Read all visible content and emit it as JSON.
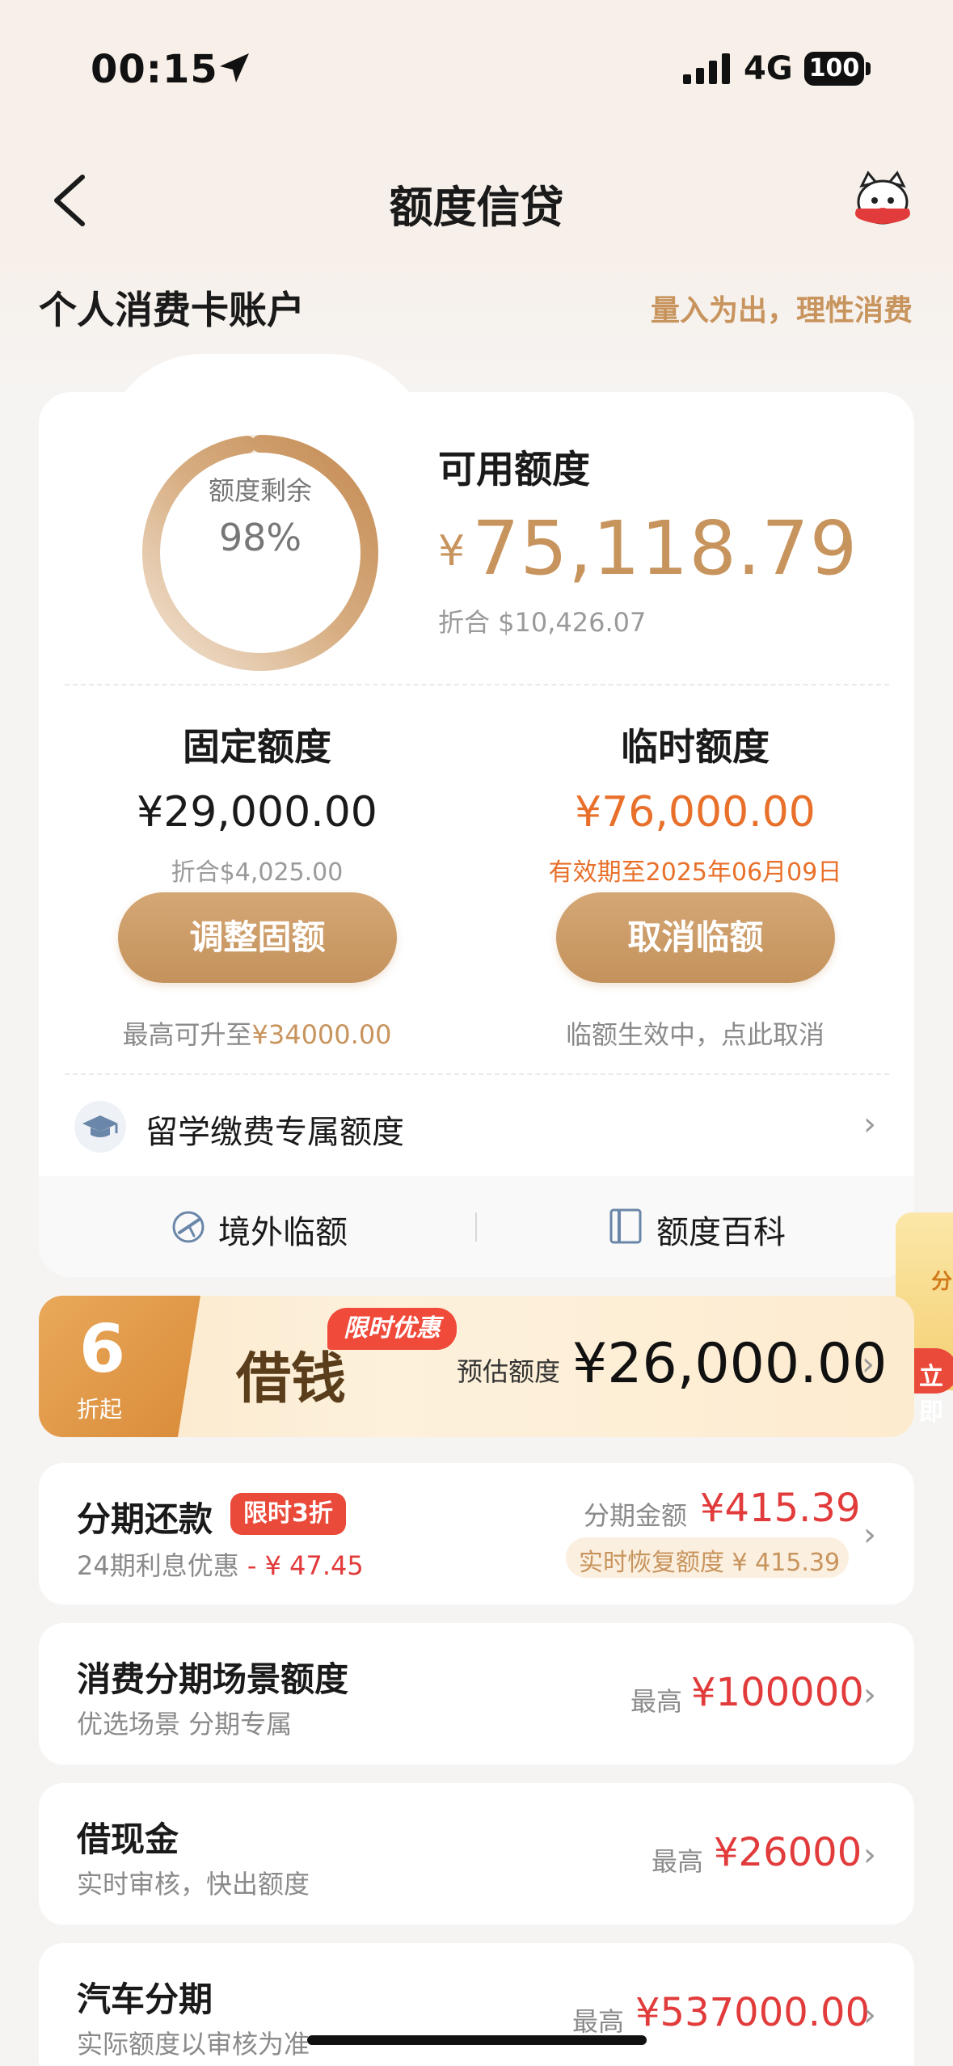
{
  "status_bar": {
    "time": "00:15",
    "network": "4G",
    "battery": "100"
  },
  "nav": {
    "title": "额度信贷"
  },
  "account": {
    "title": "个人消费卡账户",
    "slogan": "量入为出，理性消费"
  },
  "usage": {
    "label": "额度剩余",
    "percent_text": "98%",
    "percent_value": 0.98
  },
  "available": {
    "label": "可用额度",
    "currency": "¥",
    "amount": "75,118.79",
    "converted": "折合 $10,426.07"
  },
  "fixed": {
    "title": "固定额度",
    "amount": "¥29,000.00",
    "converted": "折合$4,025.00",
    "button": "调整固额",
    "note_prefix": "最高可升至",
    "note_value": "¥34000.00"
  },
  "temporary": {
    "title": "临时额度",
    "amount": "¥76,000.00",
    "validity": "有效期至2025年06月09日",
    "button": "取消临额",
    "note": "临额生效中，点此取消"
  },
  "study": {
    "label": "留学缴费专属额度"
  },
  "tools": {
    "overseas": "境外临额",
    "wiki": "额度百科"
  },
  "loan_banner": {
    "discount_num": "6",
    "discount_suffix": "折起",
    "tag": "限时优惠",
    "title": "借钱",
    "est_label": "预估额度",
    "est_amount": "¥26,000.00"
  },
  "side_float": {
    "text_top": "分",
    "text_btn": "立即"
  },
  "items": [
    {
      "title": "分期还款",
      "tag": "限时3折",
      "sub_prefix": "24期利息优惠",
      "sub_value": "- ¥ 47.45",
      "right_label": "分期金额",
      "right_amount": "¥415.39",
      "chip": "实时恢复额度 ¥ 415.39"
    },
    {
      "title": "消费分期场景额度",
      "sub": "优选场景 分期专属",
      "right_label": "最高",
      "right_amount": "¥100000"
    },
    {
      "title": "借现金",
      "sub": "实时审核，快出额度",
      "right_label": "最高",
      "right_amount": "¥26000"
    },
    {
      "title": "汽车分期",
      "sub": "实际额度以审核为准",
      "right_label": "最高",
      "right_amount": "¥537000.00"
    }
  ],
  "colors": {
    "gold": "#c8945d",
    "red": "#e23b3b",
    "orange": "#e8702a"
  }
}
